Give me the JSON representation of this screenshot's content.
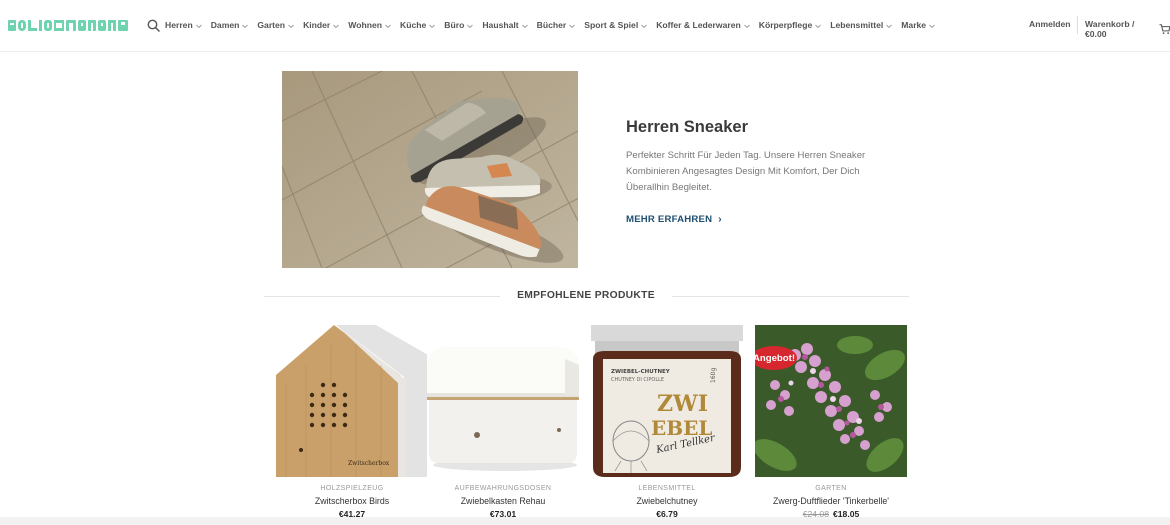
{
  "header": {
    "logo_text": "SOLIDMARKT",
    "nav": [
      {
        "label": "Herren"
      },
      {
        "label": "Damen"
      },
      {
        "label": "Garten"
      },
      {
        "label": "Kinder"
      },
      {
        "label": "Wohnen"
      },
      {
        "label": "Küche"
      },
      {
        "label": "Büro"
      },
      {
        "label": "Haushalt"
      },
      {
        "label": "Bücher"
      },
      {
        "label": "Sport & Spiel"
      },
      {
        "label": "Koffer & Lederwaren"
      },
      {
        "label": "Körperpflege"
      },
      {
        "label": "Lebensmittel"
      },
      {
        "label": "Marke"
      }
    ],
    "login_label": "Anmelden",
    "cart_label": "Warenkorb / €0.00",
    "icons": {
      "search": "search-icon",
      "chevron": "chevron-down-icon",
      "cart": "cart-icon"
    },
    "logo_color": "#6fd3b0"
  },
  "hero": {
    "title": "Herren Sneaker",
    "text": "Perfekter Schritt Für Jeden Tag. Unsere Herren Sneaker Kombinieren Angesagtes Design Mit Komfort, Der Dich Überallhin Begleitet.",
    "link_label": "MEHR ERFAHREN",
    "link_color": "#1d4f70"
  },
  "featured": {
    "title": "EMPFOHLENE PRODUKTE",
    "products": [
      {
        "category": "HOLZSPIELZEUG",
        "name": "Zwitscherbox Birds",
        "price": "€41.27"
      },
      {
        "category": "AUFBEWAHRUNGSDOSEN",
        "name": "Zwiebelkasten Rehau",
        "price": "€73.01"
      },
      {
        "category": "LEBENSMITTEL",
        "name": "Zwiebelchutney",
        "price": "€6.79",
        "label_lines": [
          "ZWIEBEL-CHUTNEY",
          "CHUTNEY DI CIPOLLE",
          "ZWI",
          "EBEL",
          "Karl Tellker",
          "160g"
        ]
      },
      {
        "category": "GARTEN",
        "name": "Zwerg-Duftflieder 'Tinkerbelle'",
        "old_price": "€24.08",
        "price": "€18.05",
        "badge": "Angebot!"
      }
    ],
    "box_logo_text": "Zwitscherbox"
  }
}
